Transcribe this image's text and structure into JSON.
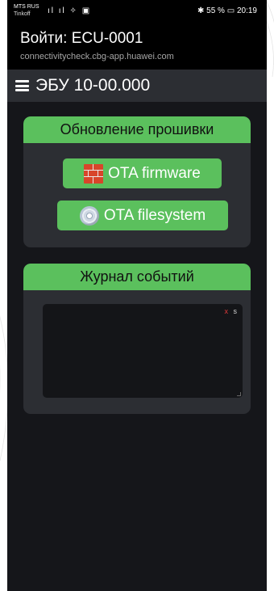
{
  "status_bar": {
    "carrier_line1": "MTS RUS",
    "carrier_line2": "Tinkoff",
    "signal_icons": "ıl ıl ✧ ▣",
    "right_text": "55 %",
    "time": "20:19"
  },
  "login": {
    "title": "Войти: ECU-0001",
    "url": "connectivitycheck.cbg-app.huawei.com"
  },
  "app_bar": {
    "title": "ЭБУ 10-00.000"
  },
  "firmware_card": {
    "header": "Обновление прошивки",
    "buttons": [
      {
        "label": "OTA firmware",
        "icon": "brick-icon"
      },
      {
        "label": "OTA filesystem",
        "icon": "disc-icon"
      }
    ]
  },
  "log_card": {
    "header": "Журнал событий",
    "clear_label": "x",
    "save_label": "s"
  },
  "colors": {
    "accent_green": "#5bc05d",
    "panel_bg": "#2c2e33",
    "page_bg": "#15161a"
  }
}
